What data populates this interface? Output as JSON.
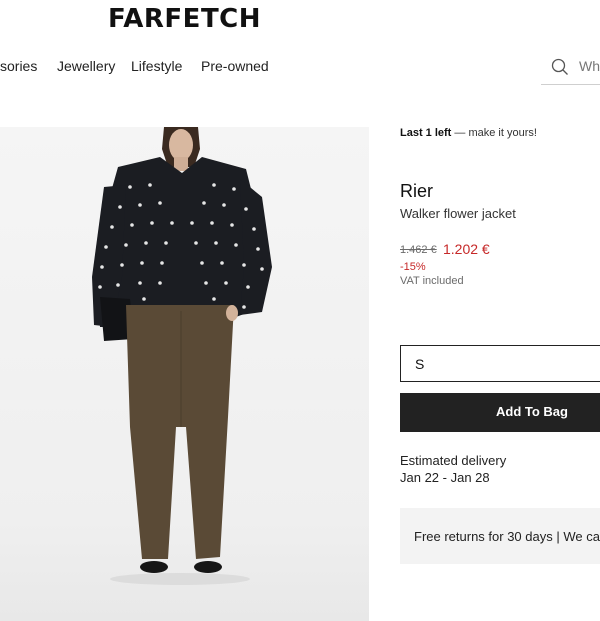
{
  "header": {
    "logo": "FARFETCH"
  },
  "nav": {
    "items": [
      {
        "label": "sories"
      },
      {
        "label": "Jewellery"
      },
      {
        "label": "Lifestyle"
      },
      {
        "label": "Pre-owned"
      }
    ]
  },
  "search": {
    "placeholder": "Wha",
    "icon": "search-icon"
  },
  "product": {
    "stock_strong": "Last 1 left",
    "stock_rest": " — make it yours!",
    "brand": "Rier",
    "name": "Walker flower jacket",
    "old_price": "1.462 €",
    "price": "1.202 €",
    "discount": "-15%",
    "vat": "VAT included",
    "price_color": "#c62828"
  },
  "size_select": {
    "value": "S"
  },
  "add_to_bag": {
    "label": "Add To Bag"
  },
  "delivery": {
    "label": "Estimated delivery",
    "dates": "Jan 22 - Jan 28"
  },
  "returns": {
    "text": "Free returns for 30 days | We ca"
  }
}
